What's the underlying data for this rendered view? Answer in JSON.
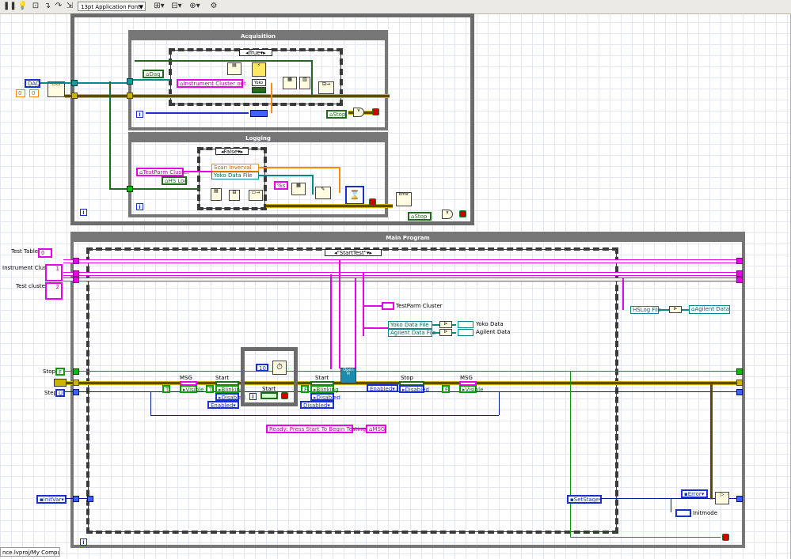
{
  "toolbar": {
    "font_label": "13pt Application Font",
    "icons": [
      "pause-icon",
      "highlight-bulb-icon",
      "retain-values-icon",
      "step-into-icon",
      "step-over-icon",
      "step-out-icon",
      "align-icon",
      "distribute-icon",
      "reorder-icon",
      "cleanup-icon"
    ]
  },
  "acquisition": {
    "title": "Acquisition",
    "case_selector": "True",
    "daq_local": "Daq",
    "instrument_cluster_out": "Instrument Cluster out",
    "yoko_label": "Yoko",
    "stop_local": "Stop",
    "iteration": "i"
  },
  "logging": {
    "title": "Logging",
    "case_selector": "False",
    "testparm_cluster": "TestParm Cluster",
    "hs_log": "HS Log",
    "scan_interval": "Scan Inverval",
    "yoko_data_file": "Yoko Data File",
    "format_string": "%s",
    "stop_local": "Stop",
    "error_label": "Error",
    "iteration": "i"
  },
  "left_inputs": {
    "daq": "DAQ",
    "zero_a": "0",
    "zero_b": "0",
    "test_table": "Test Table",
    "instrument_cluster": "Instrument Cluster",
    "test_cluster": "Test cluster",
    "stop": "Stop",
    "step": "Step",
    "initvar": "InitVar",
    "tt_val": "0",
    "ic_val": "1",
    "tc_val": "2"
  },
  "main": {
    "title": "Main Program",
    "case_selector": "\"StartTest\"",
    "testparm_cluster": "TestParm Cluster",
    "yoko_data_file": "Yoko Data File",
    "agilent_data_file": "Agilent Data File",
    "yoko_data": "Yoko Data",
    "agilent_data": "Agilent Data",
    "hslog_file": "HSLog File",
    "agilent_data_out": "Agilent Data",
    "msg_a": "MSG",
    "visible_a": "Visible",
    "start_a": "Start",
    "blinking_a": "Blinking",
    "disabled_a": "Disabled",
    "enabled_a": "Enabled",
    "wait_ms": "10",
    "start_inner": "Start",
    "start_b": "Start",
    "blinking_b": "Blinking",
    "disabled_b": "Disabled",
    "disabled_c": "Disabled",
    "open_label": "Open",
    "stop_label": "Stop",
    "enabled_b": "Enabled",
    "disabled_d": "Disabled",
    "msg_b": "MSG",
    "visible_b": "Visible",
    "true_const": "T",
    "false_const": "F",
    "ready_string": "Ready: Press Start To Begin Testing",
    "msg_local": "MSG",
    "setstage": "SetStage",
    "error": "Error",
    "initmode": "Initmode",
    "iteration": "i"
  },
  "project_path": "nce.lvproj/My Computer"
}
